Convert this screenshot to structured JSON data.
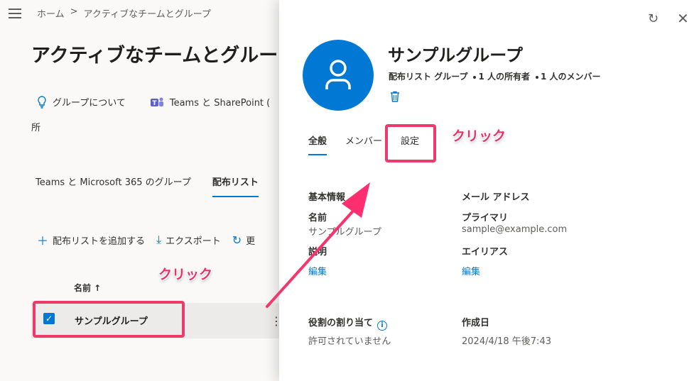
{
  "background": {
    "breadcrumb": [
      "ホーム",
      ">",
      "アクティブなチームとグループ"
    ],
    "page_title": "アクティブなチームとグルー",
    "info_links": {
      "about": "グループについて",
      "teams_sharepoint": "Teams と SharePoint (",
      "wrap": "所"
    },
    "tabs": [
      "Teams と Microsoft 365 のグループ",
      "配布リスト"
    ],
    "toolbar": {
      "add": "配布リストを追加する",
      "export": "エクスポート",
      "refresh": "更"
    },
    "column_name": "名前 ↑",
    "row": {
      "name": "サンプルグループ"
    }
  },
  "panel": {
    "title": "サンプルグループ",
    "meta": {
      "type": "配布リスト グループ",
      "owners": "1 人の所有者",
      "members": "1 人のメンバー"
    },
    "tabs": [
      "全般",
      "メンバー",
      "設定"
    ],
    "basic_info": {
      "heading": "基本情報",
      "name_label": "名前",
      "name_value": "サンプルグループ",
      "desc_label": "説明",
      "edit": "編集"
    },
    "email": {
      "heading": "メール アドレス",
      "primary_label": "プライマリ",
      "primary_value": "sample@example.com",
      "alias_label": "エイリアス",
      "edit": "編集"
    },
    "roles": {
      "label": "役割の割り当て",
      "value": "許可されていません"
    },
    "created": {
      "label": "作成日",
      "value": "2024/4/18 午後7:43"
    }
  },
  "annotations": {
    "click_left": "クリック",
    "click_right": "クリック"
  },
  "colors": {
    "accent": "#0078d4",
    "annotation": "#ee3a6b"
  }
}
